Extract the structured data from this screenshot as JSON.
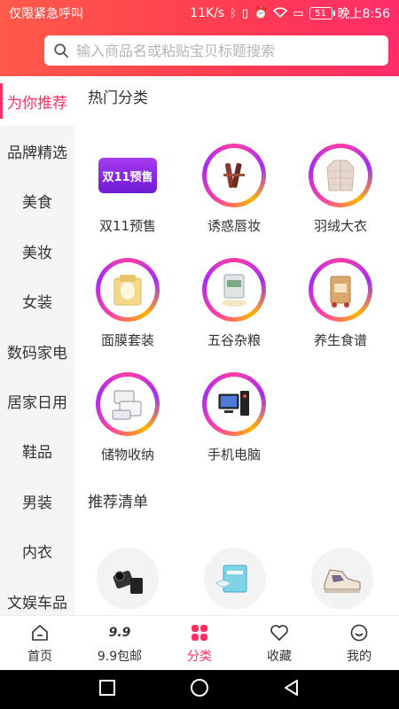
{
  "status": {
    "left": "仅限紧急呼叫",
    "speed": "11K/s",
    "battery": "51",
    "time": "晚上8:56"
  },
  "search": {
    "placeholder": "输入商品名或粘贴宝贝标题搜索"
  },
  "sidebar": {
    "items": [
      {
        "label": "为你推荐",
        "active": true
      },
      {
        "label": "品牌精选"
      },
      {
        "label": "美食"
      },
      {
        "label": "美妆"
      },
      {
        "label": "女装"
      },
      {
        "label": "数码家电"
      },
      {
        "label": "居家日用"
      },
      {
        "label": "鞋品"
      },
      {
        "label": "男装"
      },
      {
        "label": "内衣"
      },
      {
        "label": "文娱车品"
      }
    ]
  },
  "hot": {
    "title": "热门分类",
    "items": [
      {
        "label": "双11预售",
        "icon": "double11-presale-badge",
        "badge_text": "双11预售"
      },
      {
        "label": "诱惑唇妆",
        "icon": "lipstick-icon"
      },
      {
        "label": "羽绒大衣",
        "icon": "down-jacket-icon"
      },
      {
        "label": "面膜套装",
        "icon": "face-mask-icon"
      },
      {
        "label": "五谷杂粮",
        "icon": "grain-bag-icon"
      },
      {
        "label": "养生食谱",
        "icon": "health-food-icon"
      },
      {
        "label": "储物收纳",
        "icon": "storage-box-icon"
      },
      {
        "label": "手机电脑",
        "icon": "computer-icon"
      }
    ]
  },
  "recommend": {
    "title": "推荐清单",
    "items": [
      {
        "icon": "camera-icon"
      },
      {
        "icon": "mask-box-icon"
      },
      {
        "icon": "sneaker-icon"
      }
    ]
  },
  "nav": {
    "items": [
      {
        "label": "首页",
        "icon": "home-icon"
      },
      {
        "label": "9.9包邮",
        "icon": "nine-nine-icon",
        "icon_text": "9.9"
      },
      {
        "label": "分类",
        "icon": "category-icon",
        "active": true
      },
      {
        "label": "收藏",
        "icon": "heart-icon"
      },
      {
        "label": "我的",
        "icon": "smile-icon"
      }
    ]
  },
  "colors": {
    "accent": "#ff2e63",
    "header_start": "#ff5a4a",
    "header_end": "#ff2d6a"
  }
}
